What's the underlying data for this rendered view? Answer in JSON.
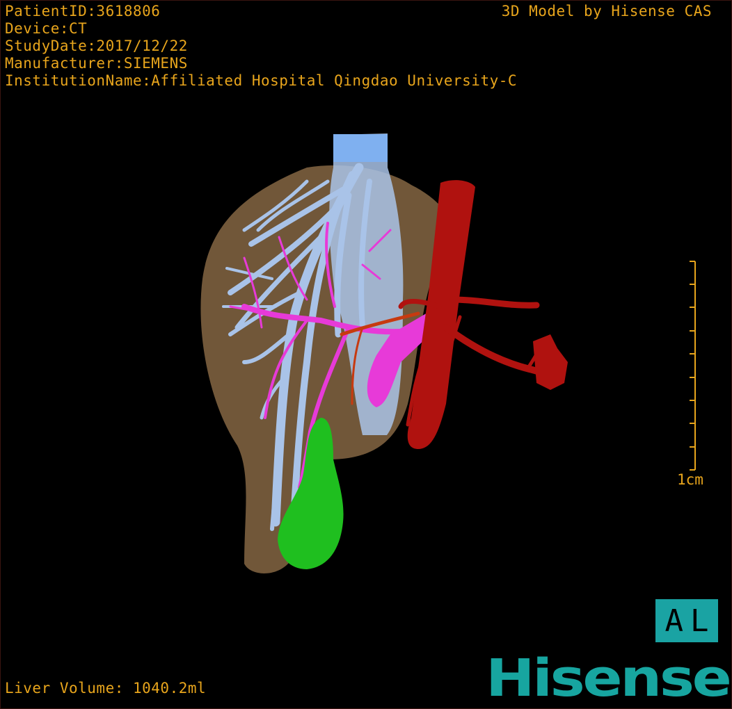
{
  "header": {
    "patient_id": "PatientID:3618806",
    "device": "Device:CT",
    "study_date": "StudyDate:2017/12/22",
    "manufacturer": "Manufacturer:SIEMENS",
    "institution": "InstitutionName:Affiliated Hospital Qingdao University-C",
    "model_credit": "3D Model by Hisense CAS"
  },
  "scale": {
    "label": "1cm"
  },
  "orientation": {
    "label": "AL"
  },
  "footer": {
    "liver_volume": "Liver Volume: 1040.2ml"
  },
  "brand": {
    "logo_text": "Hisense"
  },
  "colors": {
    "overlay_text": "#e8a51c",
    "liver": "#8a6a45",
    "hepatic_vein": "#a9c3e8",
    "inferior_vena_cava": "#7fb0f0",
    "portal_vein": "#e73ad8",
    "artery": "#b0120f",
    "tumor": "#1fbf1f",
    "brand": "#17a5a0"
  }
}
